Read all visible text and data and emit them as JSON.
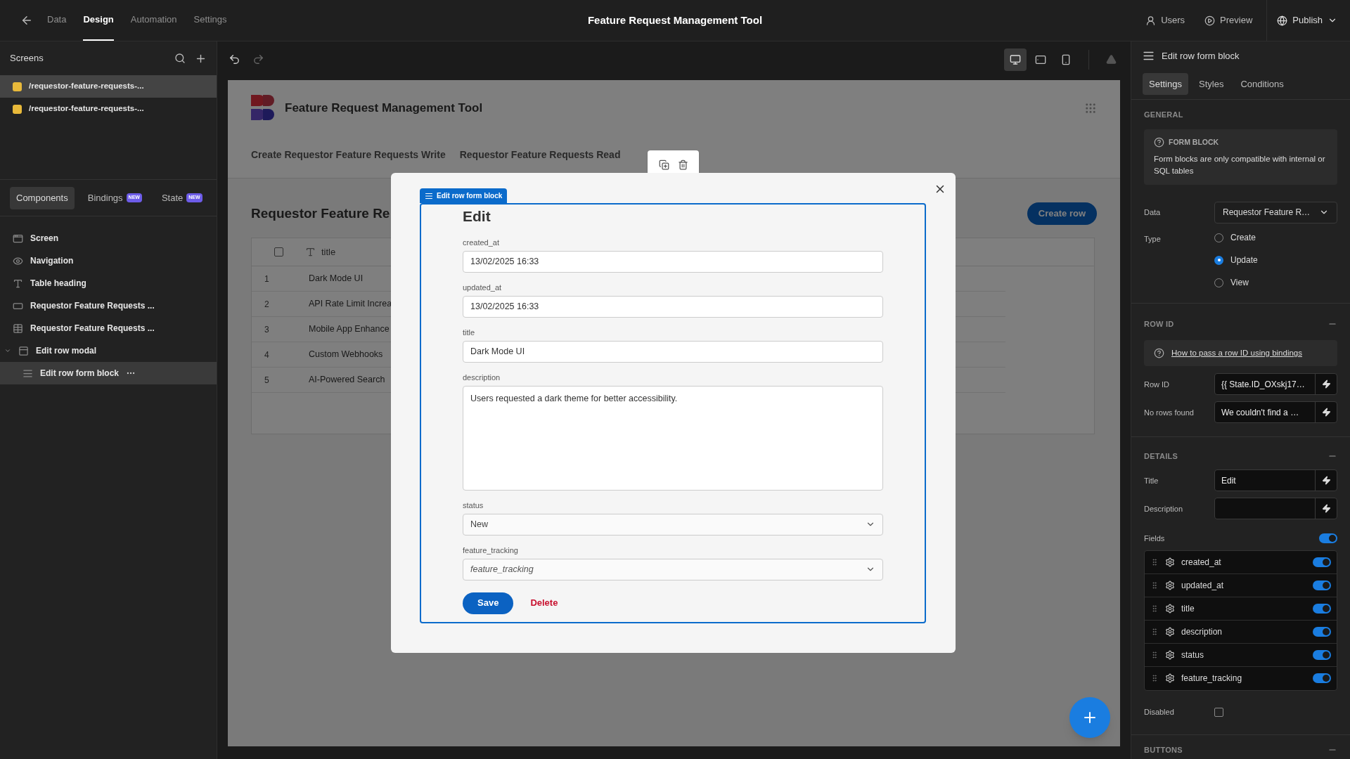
{
  "top_bar": {
    "nav_tabs": [
      {
        "label": "Data",
        "selected": false
      },
      {
        "label": "Design",
        "selected": true
      },
      {
        "label": "Automation",
        "selected": false
      },
      {
        "label": "Settings",
        "selected": false
      }
    ],
    "title": "Feature Request Management Tool",
    "users": "Users",
    "preview": "Preview",
    "publish": "Publish"
  },
  "screens_panel": {
    "title": "Screens",
    "screens": [
      {
        "label": "/requestor-feature-requests-...",
        "selected": true,
        "color": "#e8b93a"
      },
      {
        "label": "/requestor-feature-requests-...",
        "selected": false,
        "color": "#e8b93a"
      }
    ]
  },
  "components_panel": {
    "tabs": [
      {
        "label": "Components",
        "selected": true
      },
      {
        "label": "Bindings",
        "badge": "NEW",
        "selected": false
      },
      {
        "label": "State",
        "badge": "NEW",
        "selected": false
      }
    ],
    "tree": [
      {
        "label": "Screen",
        "kind": "screen",
        "selected": false
      },
      {
        "label": "Navigation",
        "kind": "navigation",
        "selected": false
      },
      {
        "label": "Table heading",
        "kind": "heading",
        "selected": false
      },
      {
        "label": "Requestor Feature Requests ...",
        "kind": "button",
        "selected": false
      },
      {
        "label": "Requestor Feature Requests ...",
        "kind": "table",
        "selected": false
      },
      {
        "label": "Edit row modal",
        "kind": "modal",
        "selected": false,
        "expanded": true,
        "children": [
          {
            "label": "Edit row form block",
            "kind": "form",
            "selected": true
          }
        ]
      }
    ]
  },
  "canvas": {
    "app_title": "Feature Request Management Tool",
    "nav_links": [
      "Create Requestor Feature Requests Write",
      "Requestor Feature Requests Read"
    ],
    "heading": "Requestor Feature Re",
    "create_button": "Create row",
    "table": {
      "select_all_checked": false,
      "columns": [
        "title"
      ],
      "rows": [
        {
          "index": "1",
          "title": "Dark Mode UI"
        },
        {
          "index": "2",
          "title": "API Rate Limit Increa"
        },
        {
          "index": "3",
          "title": "Mobile App Enhance"
        },
        {
          "index": "4",
          "title": "Custom Webhooks"
        },
        {
          "index": "5",
          "title": "AI-Powered Search"
        }
      ]
    }
  },
  "modal": {
    "block_tag": "Edit row form block",
    "title": "Edit",
    "fields": [
      {
        "label": "created_at",
        "kind": "text",
        "value": "13/02/2025 16:33"
      },
      {
        "label": "updated_at",
        "kind": "text",
        "value": "13/02/2025 16:33"
      },
      {
        "label": "title",
        "kind": "text",
        "value": "Dark Mode UI"
      },
      {
        "label": "description",
        "kind": "textarea",
        "value": "Users requested a dark theme for better accessibility."
      },
      {
        "label": "status",
        "kind": "select",
        "value": "New"
      },
      {
        "label": "feature_tracking",
        "kind": "select",
        "placeholder": "feature_tracking"
      }
    ],
    "save": "Save",
    "delete": "Delete"
  },
  "settings_panel": {
    "title": "Edit row form block",
    "tabs": [
      {
        "label": "Settings",
        "selected": true
      },
      {
        "label": "Styles",
        "selected": false
      },
      {
        "label": "Conditions",
        "selected": false
      }
    ],
    "general": {
      "heading": "GENERAL",
      "info_title": "FORM BLOCK",
      "info_text": "Form blocks are only compatible with internal or SQL tables",
      "data_label": "Data",
      "data_value": "Requestor Feature R…",
      "type_label": "Type",
      "type_options": [
        {
          "label": "Create",
          "selected": false
        },
        {
          "label": "Update",
          "selected": true
        },
        {
          "label": "View",
          "selected": false
        }
      ]
    },
    "row_id": {
      "heading": "ROW ID",
      "link": "How to pass a row ID using bindings",
      "inputs": [
        {
          "label": "Row ID",
          "value": "{{ State.ID_OXskj17…"
        },
        {
          "label": "No rows found",
          "value": "We couldn't find a …"
        }
      ]
    },
    "details": {
      "heading": "DETAILS",
      "inputs": [
        {
          "label": "Title",
          "value": "Edit"
        },
        {
          "label": "Description"
        }
      ],
      "fields_label": "Fields",
      "fields_on": true,
      "fields": [
        {
          "label": "created_at",
          "on": true
        },
        {
          "label": "updated_at",
          "on": true
        },
        {
          "label": "title",
          "on": true
        },
        {
          "label": "description",
          "on": true
        },
        {
          "label": "status",
          "on": true
        },
        {
          "label": "feature_tracking",
          "on": true
        }
      ],
      "disabled_label": "Disabled",
      "disabled_checked": false
    },
    "buttons_heading": "BUTTONS"
  }
}
